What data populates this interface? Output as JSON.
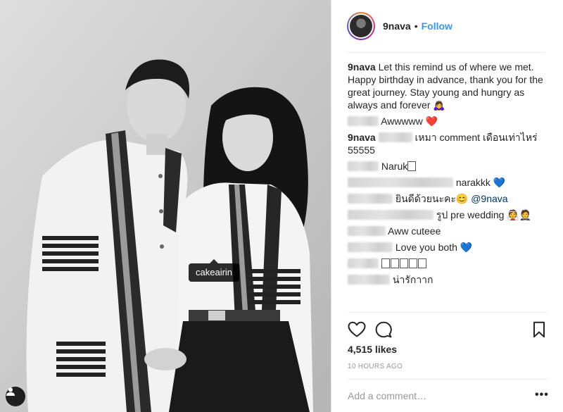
{
  "photo": {
    "tag_label": "cakeairin",
    "tag_button_icon": "person-tag-icon"
  },
  "post": {
    "username": "9nava",
    "separator": "•",
    "follow_label": "Follow"
  },
  "caption": {
    "username": "9nava",
    "text": "Let this remind us of where we met. Happy birthday in advance, thank you for the great journey. Stay young and hungry as always and forever",
    "emoji": "🙇‍♀️"
  },
  "comments": [
    {
      "text": "Awwwww",
      "emoji": "❤️"
    },
    {
      "username": "9nava",
      "text_a": "เหมา comment เดือนเท่าไหร่",
      "text_b": "55555"
    },
    {
      "text": "Naruk"
    },
    {
      "text": "narakkk",
      "emoji": "💙"
    },
    {
      "text": "ยินดีด้วยนะคะ",
      "emoji": "😊",
      "mention": "@9nava"
    },
    {
      "text": "รูป pre wedding",
      "emoji": "👰🤵"
    },
    {
      "text": "Aww cuteee"
    },
    {
      "text": "Love you both",
      "emoji": "💙"
    },
    {
      "text": ""
    },
    {
      "text": "น่ารักาาก"
    }
  ],
  "actions": {
    "like_icon": "heart-icon",
    "comment_icon": "comment-icon",
    "save_icon": "bookmark-icon"
  },
  "likes": "4,515 likes",
  "timestamp": "10 HOURS AGO",
  "add_comment": {
    "placeholder": "Add a comment…",
    "more_label": "•••"
  }
}
